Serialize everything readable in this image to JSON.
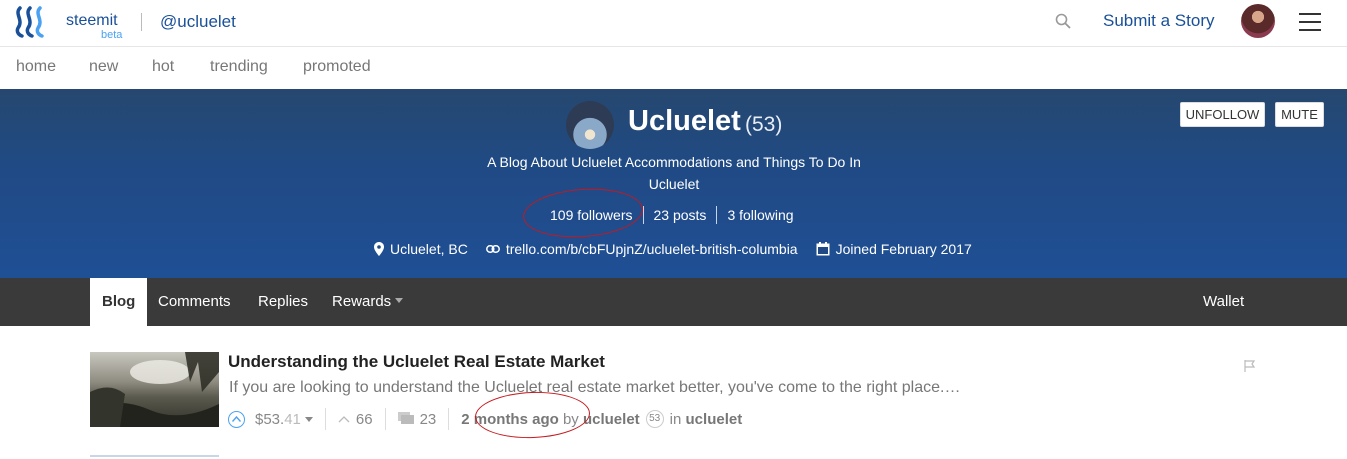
{
  "header": {
    "brand": "steemit",
    "beta": "beta",
    "username": "@ucluelet",
    "submit_label": "Submit a Story"
  },
  "subnav": [
    "home",
    "new",
    "hot",
    "trending",
    "promoted"
  ],
  "profile": {
    "name": "Ucluelet",
    "reputation": "(53)",
    "about": "A Blog About Ucluelet Accommodations and Things To Do In Ucluelet",
    "followers": "109 followers",
    "posts": "23 posts",
    "following": "3 following",
    "location": "Ucluelet, BC",
    "website": "trello.com/b/cbFUpjnZ/ucluelet-british-columbia",
    "joined": "Joined February 2017",
    "unfollow_label": "UNFOLLOW",
    "mute_label": "MUTE"
  },
  "tabs": {
    "blog": "Blog",
    "comments": "Comments",
    "replies": "Replies",
    "rewards": "Rewards",
    "wallet": "Wallet"
  },
  "post": {
    "title": "Understanding the Ucluelet Real Estate Market",
    "excerpt": "If you are looking to understand the Ucluelet real estate market better, you've come to the right place.…",
    "payout_main": "$53.",
    "payout_cents": "41",
    "votes": "66",
    "comments": "23",
    "time": "2 months ago",
    "by": "by",
    "author": "ucluelet",
    "author_rep": "53",
    "in": "in",
    "category": "ucluelet"
  },
  "colors": {
    "brand_blue": "#1a5099",
    "banner": "#204a84",
    "tab_bar": "#3a3a3a",
    "annotation_red": "#c4191f"
  }
}
